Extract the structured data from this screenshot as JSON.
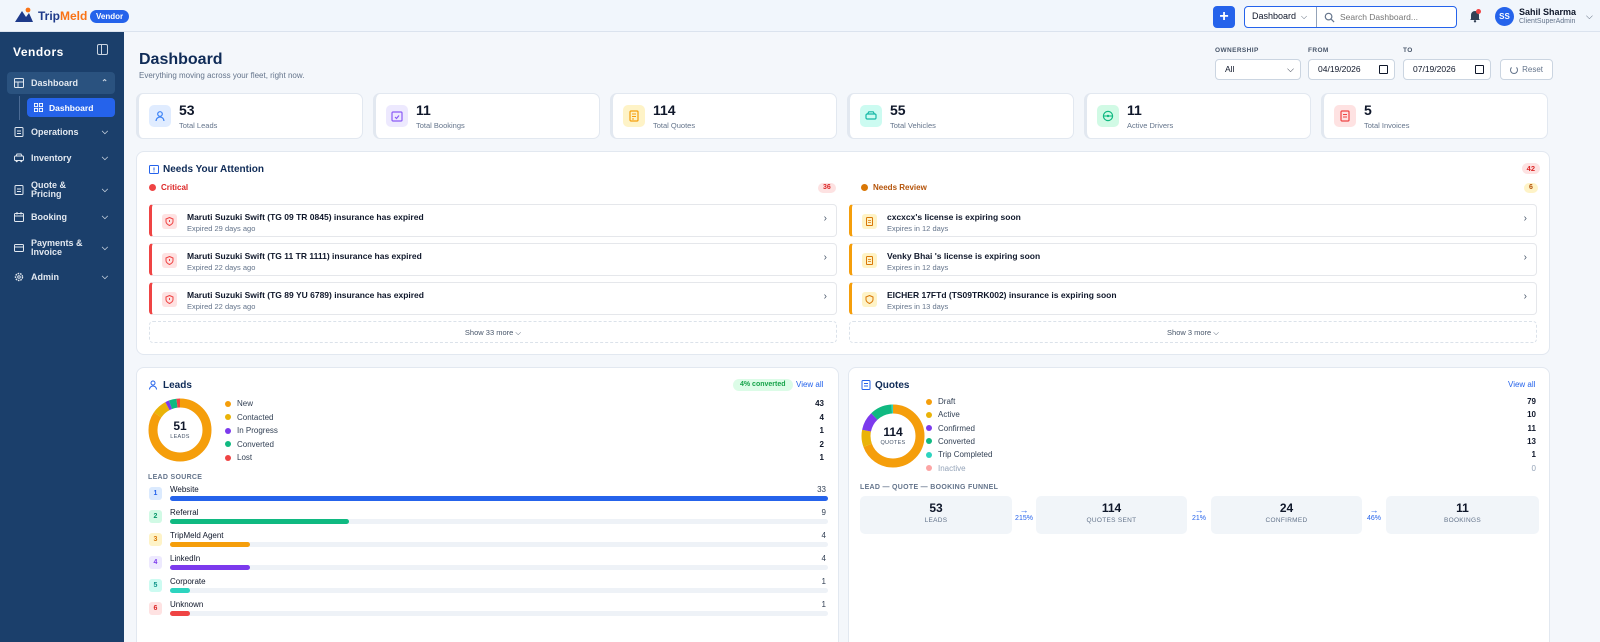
{
  "app": {
    "brand_a": "Trip",
    "brand_b": "Meld",
    "badge": "Vendor"
  },
  "topbar": {
    "scope": "Dashboard",
    "search_placeholder": "Search Dashboard...",
    "user": {
      "initials": "SS",
      "name": "Sahil Sharma",
      "role": "ClientSuperAdmin"
    }
  },
  "sidebar": {
    "title": "Vendors",
    "items": [
      {
        "label": "Dashboard",
        "icon": "grid-icon"
      },
      {
        "label": "Operations",
        "icon": "document-icon"
      },
      {
        "label": "Inventory",
        "icon": "car-icon"
      },
      {
        "label": "Quote & Pricing",
        "icon": "document-icon"
      },
      {
        "label": "Booking",
        "icon": "calendar-icon"
      },
      {
        "label": "Payments & Invoice",
        "icon": "card-icon"
      },
      {
        "label": "Admin",
        "icon": "gear-icon"
      }
    ],
    "sub_item": "Dashboard"
  },
  "header": {
    "title": "Dashboard",
    "subtitle": "Everything moving across your fleet, right now.",
    "filters": {
      "ownership_label": "OWNERSHIP",
      "ownership_value": "All",
      "from_label": "FROM",
      "from_value": "04/19/2026",
      "to_label": "TO",
      "to_value": "07/19/2026",
      "reset": "Reset"
    }
  },
  "stats": [
    {
      "value": "53",
      "label": "Total Leads",
      "color": "#3b82f6"
    },
    {
      "value": "11",
      "label": "Total Bookings",
      "color": "#8b5cf6"
    },
    {
      "value": "114",
      "label": "Total Quotes",
      "color": "#f59e0b"
    },
    {
      "value": "55",
      "label": "Total Vehicles",
      "color": "#14b8a6"
    },
    {
      "value": "11",
      "label": "Active Drivers",
      "color": "#10b981"
    },
    {
      "value": "5",
      "label": "Total Invoices",
      "color": "#ef4444"
    }
  ],
  "attention": {
    "title": "Needs Your Attention",
    "total": "42",
    "critical": {
      "label": "Critical",
      "count": "36",
      "items": [
        {
          "title": "Maruti Suzuki Swift (TG 09 TR 0845) insurance has expired",
          "sub": "Expired 29 days ago"
        },
        {
          "title": "Maruti Suzuki Swift (TG 11 TR 1111) insurance has expired",
          "sub": "Expired 22 days ago"
        },
        {
          "title": "Maruti Suzuki Swift (TG 89 YU 6789) insurance has expired",
          "sub": "Expired 22 days ago"
        }
      ],
      "more": "Show 33 more"
    },
    "review": {
      "label": "Needs Review",
      "count": "6",
      "items": [
        {
          "title": "cxcxcx's license is expiring soon",
          "sub": "Expires in 12 days"
        },
        {
          "title": "Venky Bhai 's license is expiring soon",
          "sub": "Expires in 12 days"
        },
        {
          "title": "EICHER 17FTd (TS09TRK002) insurance is expiring soon",
          "sub": "Expires in 13 days"
        }
      ],
      "more": "Show 3 more"
    }
  },
  "leads": {
    "title": "Leads",
    "converted_pill": "4% converted",
    "view_all": "View all",
    "total": "51",
    "total_label": "LEADS",
    "breakdown": [
      {
        "label": "New",
        "value": 43,
        "color": "#f59e0b"
      },
      {
        "label": "Contacted",
        "value": 4,
        "color": "#eab308"
      },
      {
        "label": "In Progress",
        "value": 1,
        "color": "#7c3aed"
      },
      {
        "label": "Converted",
        "value": 2,
        "color": "#10b981"
      },
      {
        "label": "Lost",
        "value": 1,
        "color": "#ef4444"
      }
    ],
    "source_title": "LEAD SOURCE",
    "sources": [
      {
        "rank": "1",
        "name": "Website",
        "value": 33,
        "color": "#2563eb",
        "bg": "#dbeafe",
        "fg": "#2563eb"
      },
      {
        "rank": "2",
        "name": "Referral",
        "value": 9,
        "color": "#10b981",
        "bg": "#d1fae5",
        "fg": "#059669"
      },
      {
        "rank": "3",
        "name": "TripMeld Agent",
        "value": 4,
        "color": "#f59e0b",
        "bg": "#fef3c7",
        "fg": "#d97706"
      },
      {
        "rank": "4",
        "name": "LinkedIn",
        "value": 4,
        "color": "#7c3aed",
        "bg": "#ede9fe",
        "fg": "#7c3aed"
      },
      {
        "rank": "5",
        "name": "Corporate",
        "value": 1,
        "color": "#2dd4bf",
        "bg": "#ccfbf1",
        "fg": "#0d9488"
      },
      {
        "rank": "6",
        "name": "Unknown",
        "value": 1,
        "color": "#ef4444",
        "bg": "#fee2e2",
        "fg": "#dc2626"
      }
    ]
  },
  "quotes": {
    "title": "Quotes",
    "view_all": "View all",
    "total": "114",
    "total_label": "QUOTES",
    "breakdown": [
      {
        "label": "Draft",
        "value": 79,
        "color": "#f59e0b"
      },
      {
        "label": "Active",
        "value": 10,
        "color": "#eab308"
      },
      {
        "label": "Confirmed",
        "value": 11,
        "color": "#7c3aed"
      },
      {
        "label": "Converted",
        "value": 13,
        "color": "#10b981"
      },
      {
        "label": "Trip Completed",
        "value": 1,
        "color": "#2dd4bf"
      },
      {
        "label": "Inactive",
        "value": 0,
        "color": "#fca5a5"
      }
    ],
    "funnel_title": "LEAD — QUOTE — BOOKING FUNNEL",
    "funnel": [
      {
        "value": "53",
        "label": "LEADS"
      },
      {
        "value": "114",
        "label": "QUOTES SENT"
      },
      {
        "value": "24",
        "label": "CONFIRMED"
      },
      {
        "value": "11",
        "label": "BOOKINGS"
      }
    ],
    "rates": [
      "215%",
      "21%",
      "46%"
    ]
  }
}
